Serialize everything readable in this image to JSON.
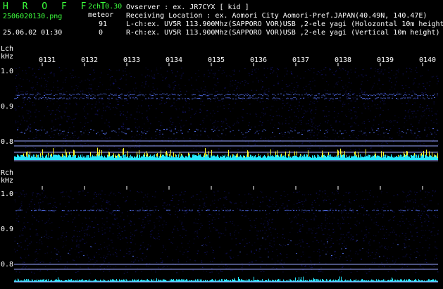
{
  "header": {
    "app_title": "H R O F F T",
    "version": "2ch 0.30",
    "filename": "2506020130.png",
    "meteor_label": "meteor",
    "lch_count": "91",
    "rch_count": "0",
    "datetime": "25.06.02 01:30",
    "observer": "Ovserver              : ex. JR7CYX [ kid ]",
    "location": "Receiving Location : ex. Aomori City Aomori-Pref.JAPAN(40.49N, 140.47E)",
    "lch_info": "L-ch:ex. UV5R 113.900Mhz(SAPPORO VOR)USB ,2-ele yagi (Holozontal 10m height)",
    "rch_info": "R-ch:ex. UV5R 113.900Mhz(SAPPORO VOR)USB ,2-ele yagi (Vertical 10m height)"
  },
  "lch": {
    "label": "Lch",
    "unit": "kHz",
    "ticks": [
      "1.0",
      "0.9",
      "0.8"
    ]
  },
  "rch": {
    "label": "Rch",
    "unit": "kHz",
    "ticks": [
      "1.0",
      "0.9",
      "0.8"
    ]
  },
  "time_labels": [
    "0131",
    "0132",
    "0133",
    "0134",
    "0135",
    "0136",
    "0137",
    "0138",
    "0139",
    "0140"
  ],
  "colors": {
    "noise": "#1a1a8c",
    "band": "#5a78ff",
    "cyan": "#26e8ff",
    "yellow": "#ffff30",
    "line": "#9aa6ff"
  }
}
